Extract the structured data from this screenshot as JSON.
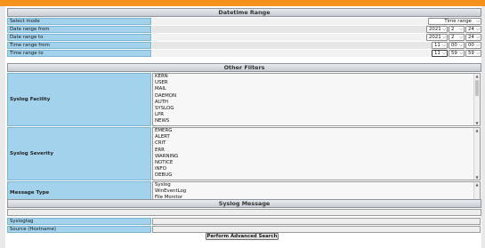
{
  "datetime_range": {
    "title": "Datetime Range",
    "select_mode": {
      "label": "Select mode",
      "value": "Time range"
    },
    "date_from": {
      "label": "Date range from",
      "year": "2021",
      "month": "2",
      "day": "24"
    },
    "date_to": {
      "label": "Date range to",
      "year": "2021",
      "month": "2",
      "day": "24"
    },
    "time_from": {
      "label": "Time range from",
      "hour": "11",
      "minute": "00",
      "second": "00"
    },
    "time_to": {
      "label": "Time range to",
      "hour": "11",
      "minute": "59",
      "second": "59"
    }
  },
  "other_filters": {
    "title": "Other Filters",
    "facility": {
      "label": "Syslog Facility",
      "options": [
        "KERN",
        "USER",
        "MAIL",
        "DAEMON",
        "AUTH",
        "SYSLOG",
        "LPR",
        "NEWS"
      ]
    },
    "severity": {
      "label": "Syslog Severity",
      "options": [
        "EMERG",
        "ALERT",
        "CRIT",
        "ERR",
        "WARNING",
        "NOTICE",
        "INFO",
        "DEBUG"
      ]
    },
    "message_type": {
      "label": "Message Type",
      "options": [
        "Syslog",
        "WinEventLog",
        "File Monitor"
      ]
    }
  },
  "syslog_message": {
    "title": "Syslog Message",
    "message_value": "",
    "syslogtag": {
      "label": "Syslogtag",
      "value": ""
    },
    "source": {
      "label": "Source (Hostname)",
      "value": ""
    }
  },
  "submit_label": "Perform Advanced Search",
  "colors": {
    "topbar": "#f5921e",
    "label_bg": "#a3d3ec"
  }
}
